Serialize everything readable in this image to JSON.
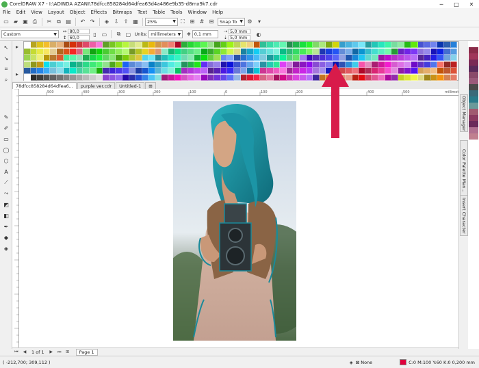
{
  "window": {
    "title": "CorelDRAW X7 - I:\\ADINDA AZANI\\78dfcc858284d64dfea63d4a486e9b35-d8mx9k7.cdr",
    "minimize_glyph": "─",
    "maximize_glyph": "□",
    "close_glyph": "✕"
  },
  "menu": [
    "File",
    "Edit",
    "View",
    "Layout",
    "Object",
    "Effects",
    "Bitmaps",
    "Text",
    "Table",
    "Tools",
    "Window",
    "Help"
  ],
  "toolbar": {
    "zoom": "25%",
    "snap_to": "Snap To"
  },
  "property_bar": {
    "page_preset": "Custom",
    "width": "80,0 mm",
    "height": "60,0 mm",
    "units_label": "Units:",
    "units": "millimeters",
    "nudge": "0,1 mm",
    "dup_x": "5,0 mm",
    "dup_y": "5,0 mm"
  },
  "tabs": [
    {
      "label": "78dfcc858284d64dfea6...",
      "active": true
    },
    {
      "label": "purple ver.cdr",
      "active": false
    },
    {
      "label": "Untitled-1",
      "active": false
    }
  ],
  "ruler": {
    "h_ticks": [
      "500",
      "400",
      "300",
      "200",
      "100",
      "0",
      "100",
      "200",
      "300",
      "400",
      "500"
    ],
    "unit": "millimeters"
  },
  "dockers": [
    "Object Manager",
    "Color Palette Man...",
    "Insert Character"
  ],
  "page_nav": {
    "counter": "1 of 1",
    "page_tab": "Page 1"
  },
  "status": {
    "coords": "( -212,700; 309,112 )",
    "fill": "None",
    "outline": "C:0 M:100 Y:60 K:0  0,200 mm"
  },
  "colors": {
    "accent_arrow": "#d81b4a",
    "hair": "#1a8a9a",
    "outline_swatch": "#e0003c"
  }
}
